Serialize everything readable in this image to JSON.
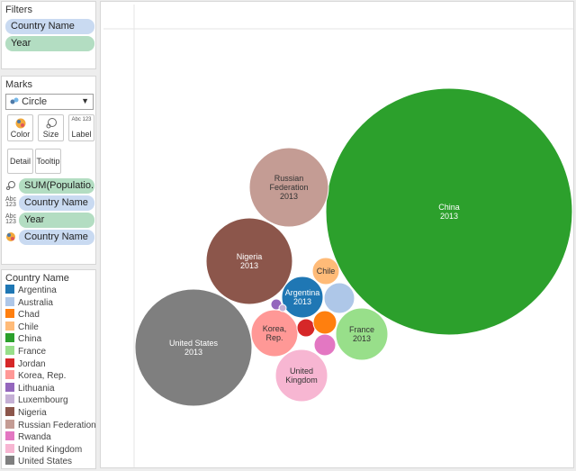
{
  "filters": {
    "title": "Filters",
    "pills": [
      "Country Name",
      "Year"
    ]
  },
  "marks": {
    "title": "Marks",
    "mark_type": "Circle",
    "buttons": {
      "color": "Color",
      "size": "Size",
      "label": "Label",
      "detail": "Detail",
      "tooltip": "Tooltip"
    },
    "label_icon_text": "Abc 123",
    "shelf": [
      "SUM(Populatio...",
      "Country Name",
      "Year",
      "Country Name"
    ]
  },
  "legend": {
    "title": "Country Name",
    "items": [
      {
        "name": "Argentina",
        "color": "#1f77b4"
      },
      {
        "name": "Australia",
        "color": "#aec7e8"
      },
      {
        "name": "Chad",
        "color": "#ff7f0e"
      },
      {
        "name": "Chile",
        "color": "#ffbb78"
      },
      {
        "name": "China",
        "color": "#2ca02c"
      },
      {
        "name": "France",
        "color": "#98df8a"
      },
      {
        "name": "Jordan",
        "color": "#d62728"
      },
      {
        "name": "Korea, Rep.",
        "color": "#ff9896"
      },
      {
        "name": "Lithuania",
        "color": "#9467bd"
      },
      {
        "name": "Luxembourg",
        "color": "#c5b0d5"
      },
      {
        "name": "Nigeria",
        "color": "#8c564b"
      },
      {
        "name": "Russian Federation",
        "color": "#c49c94"
      },
      {
        "name": "Rwanda",
        "color": "#e377c2"
      },
      {
        "name": "United Kingdom",
        "color": "#f7b6d2"
      },
      {
        "name": "United States",
        "color": "#7f7f7f"
      }
    ]
  },
  "bubbles": [
    {
      "country": "China",
      "label": [
        "China",
        "2013"
      ],
      "color": "#2ca02c",
      "text_color": "#ffffff"
    },
    {
      "country": "Russian Federation",
      "label": [
        "Russian",
        "Federation",
        "2013"
      ],
      "color": "#c49c94",
      "text_color": "#333333"
    },
    {
      "country": "Nigeria",
      "label": [
        "Nigeria",
        "2013"
      ],
      "color": "#8c564b",
      "text_color": "#ffffff"
    },
    {
      "country": "United States",
      "label": [
        "United States",
        "2013"
      ],
      "color": "#7f7f7f",
      "text_color": "#ffffff"
    },
    {
      "country": "Argentina",
      "label": [
        "Argentina",
        "2013"
      ],
      "color": "#1f77b4",
      "text_color": "#ffffff"
    },
    {
      "country": "Chile",
      "label": [
        "Chile"
      ],
      "color": "#ffbb78",
      "text_color": "#333333"
    },
    {
      "country": "Australia",
      "label": [],
      "color": "#aec7e8",
      "text_color": "#333333"
    },
    {
      "country": "France",
      "label": [
        "France",
        "2013"
      ],
      "color": "#98df8a",
      "text_color": "#333333"
    },
    {
      "country": "Korea, Rep.",
      "label": [
        "Korea,",
        "Rep."
      ],
      "color": "#ff9896",
      "text_color": "#333333"
    },
    {
      "country": "United Kingdom",
      "label": [
        "United",
        "Kingdom"
      ],
      "color": "#f7b6d2",
      "text_color": "#333333"
    },
    {
      "country": "Jordan",
      "label": [],
      "color": "#d62728",
      "text_color": "#ffffff"
    },
    {
      "country": "Chad",
      "label": [],
      "color": "#ff7f0e",
      "text_color": "#ffffff"
    },
    {
      "country": "Rwanda",
      "label": [],
      "color": "#e377c2",
      "text_color": "#ffffff"
    },
    {
      "country": "Lithuania",
      "label": [],
      "color": "#9467bd",
      "text_color": "#ffffff"
    },
    {
      "country": "Luxembourg",
      "label": [],
      "color": "#c5b0d5",
      "text_color": "#ffffff"
    }
  ]
}
